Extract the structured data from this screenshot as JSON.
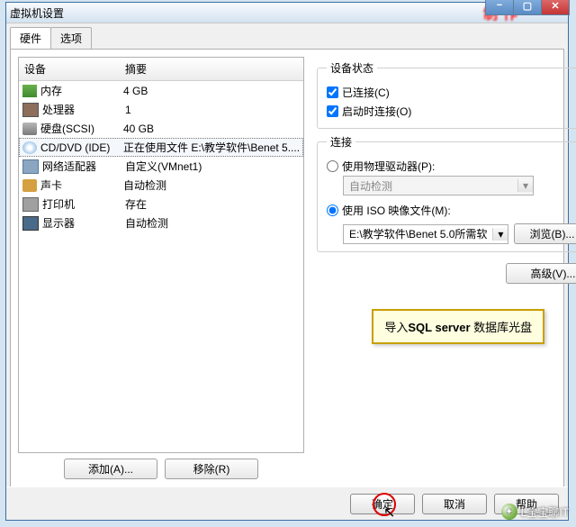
{
  "window": {
    "title": "虚拟机设置",
    "redtext": "制作"
  },
  "tabs": {
    "hw": "硬件",
    "opts": "选项"
  },
  "cols": {
    "device": "设备",
    "summary": "摘要"
  },
  "devices": {
    "mem": {
      "name": "内存",
      "summary": "4 GB"
    },
    "cpu": {
      "name": "处理器",
      "summary": "1"
    },
    "hdd": {
      "name": "硬盘(SCSI)",
      "summary": "40 GB"
    },
    "cd": {
      "name": "CD/DVD (IDE)",
      "summary": "正在使用文件 E:\\教学软件\\Benet 5...."
    },
    "nic": {
      "name": "网络适配器",
      "summary": "自定义(VMnet1)"
    },
    "snd": {
      "name": "声卡",
      "summary": "自动检测"
    },
    "prn": {
      "name": "打印机",
      "summary": "存在"
    },
    "dsp": {
      "name": "显示器",
      "summary": "自动检测"
    }
  },
  "btns": {
    "add": "添加(A)...",
    "remove": "移除(R)",
    "browse": "浏览(B)...",
    "advanced": "高级(V)..."
  },
  "status": {
    "legend": "设备状态",
    "connected": "已连接(C)",
    "connect_poweron": "启动时连接(O)"
  },
  "connection": {
    "legend": "连接",
    "use_physical": "使用物理驱动器(P):",
    "auto_detect": "自动检测",
    "use_iso": "使用 ISO 映像文件(M):",
    "iso_path": "E:\\教学软件\\Benet 5.0所需软"
  },
  "callout": {
    "pre": "导入",
    "bold": "SQL server",
    "post": " 数据库光盘"
  },
  "footer": {
    "ok": "确定",
    "cancel": "取消",
    "help": "帮助"
  },
  "watermark": "L宝宝聊IT"
}
